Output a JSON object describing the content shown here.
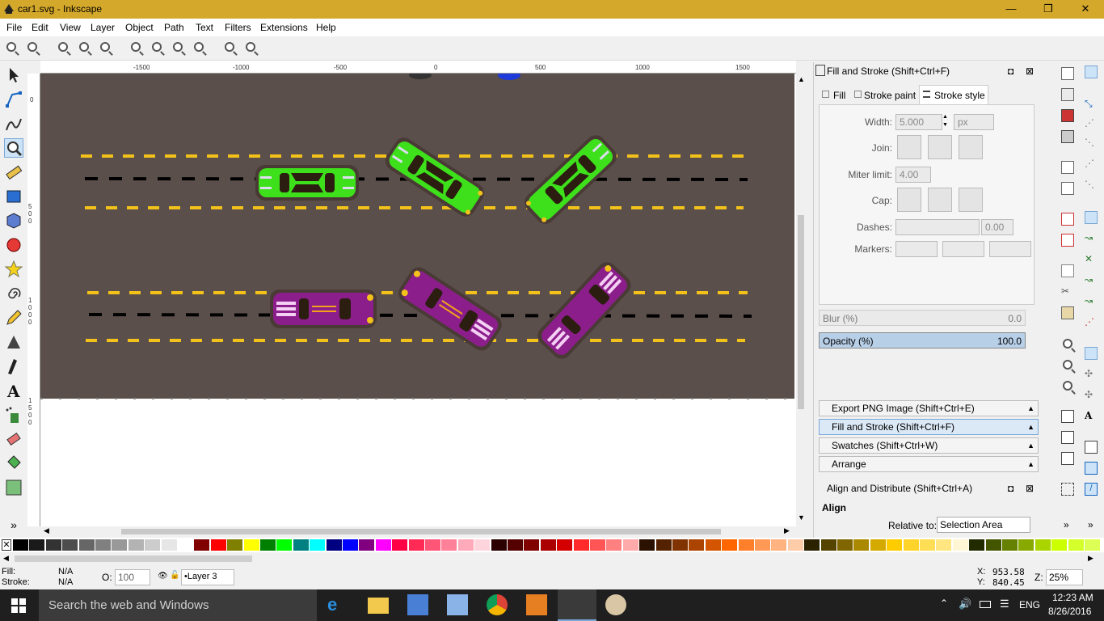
{
  "window": {
    "title": "car1.svg - Inkscape",
    "minimize": "—",
    "maximize": "❐",
    "close": "✕"
  },
  "menu": [
    "File",
    "Edit",
    "View",
    "Layer",
    "Object",
    "Path",
    "Text",
    "Filters",
    "Extensions",
    "Help"
  ],
  "ruler": {
    "top_ticks": [
      "-1500",
      "-1000",
      "-500",
      "0",
      "500",
      "1000",
      "1500"
    ],
    "left_ticks": [
      "0",
      "500",
      "1000",
      "1500"
    ]
  },
  "fill_stroke": {
    "title": "Fill and Stroke (Shift+Ctrl+F)",
    "tabs": [
      "Fill",
      "Stroke paint",
      "Stroke style"
    ],
    "width_label": "Width:",
    "width_value": "5.000",
    "unit": "px",
    "join_label": "Join:",
    "miter_label": "Miter limit:",
    "miter_value": "4.00",
    "cap_label": "Cap:",
    "dashes_label": "Dashes:",
    "dashes_value": "0.00",
    "markers_label": "Markers:",
    "blur_label": "Blur (%)",
    "blur_value": "0.0",
    "opacity_label": "Opacity (%)",
    "opacity_value": "100.0"
  },
  "docked": [
    "Export PNG Image (Shift+Ctrl+E)",
    "Fill and Stroke (Shift+Ctrl+F)",
    "Swatches (Shift+Ctrl+W)",
    "Arrange"
  ],
  "align": {
    "title": "Align and Distribute (Shift+Ctrl+A)",
    "heading": "Align",
    "relative_label": "Relative to:",
    "relative_value": "Selection Area"
  },
  "status": {
    "fill_label": "Fill:",
    "fill_value": "N/A",
    "stroke_label": "Stroke:",
    "stroke_value": "N/A",
    "opacity_label": "O:",
    "opacity_value": "100",
    "layer": "•Layer 3",
    "x_label": "X:",
    "x_value": "953.58",
    "y_label": "Y:",
    "y_value": "840.45",
    "zoom_label": "Z:",
    "zoom_value": "25%"
  },
  "taskbar": {
    "search": "Search the web and Windows",
    "time": "12:23 AM",
    "date": "8/26/2016",
    "lang": "ENG"
  },
  "colors": {
    "titlebar": "#d4a82a",
    "road": "#5a4f4a",
    "lane_yellow": "#f2c21b",
    "car_green": "#3ee01c",
    "car_purple": "#8c1e8c"
  }
}
